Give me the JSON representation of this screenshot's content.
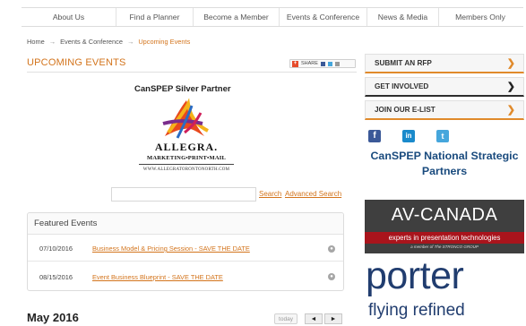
{
  "nav": {
    "items": [
      {
        "label": "About Us"
      },
      {
        "label": "Find a Planner"
      },
      {
        "label": "Become a Member"
      },
      {
        "label": "Events & Conference"
      },
      {
        "label": "News & Media"
      },
      {
        "label": "Members Only"
      }
    ]
  },
  "breadcrumb": {
    "home": "Home",
    "separator": "→",
    "section": "Events & Conference",
    "current": "Upcoming Events"
  },
  "main": {
    "title": "UPCOMING EVENTS",
    "share_label": "SHARE",
    "partner": {
      "title": "CanSPEP Silver Partner",
      "logo_name": "ALLEGRA.",
      "logo_tagline": "MARKETING•PRINT•MAIL",
      "logo_url": "WWW.ALLEGRATORONTONORTH.COM"
    },
    "search": {
      "value": "",
      "search_link": "Search",
      "advanced_link": "Advanced Search"
    },
    "featured": {
      "heading": "Featured Events",
      "events": [
        {
          "date": "07/10/2016",
          "title": "Business Model & Pricing Session - SAVE THE DATE"
        },
        {
          "date": "08/15/2016",
          "title": "Event Business Blueprint - SAVE THE DATE"
        }
      ]
    },
    "calendar": {
      "month": "May 2016",
      "today_label": "today",
      "prev_label": "◄",
      "next_label": "►"
    }
  },
  "sidebar": {
    "boxes": [
      {
        "label": "SUBMIT AN RFP",
        "chevron": "❯"
      },
      {
        "label": "GET INVOLVED",
        "chevron": "❯"
      },
      {
        "label": "JOIN OUR E-LIST",
        "chevron": "❯"
      }
    ],
    "social": {
      "facebook": "f",
      "linkedin": "in",
      "twitter": "t"
    },
    "strategic_title": "CanSPEP National Strategic Partners",
    "av_canada": {
      "name": "AV-CANADA",
      "tagline": "experts in presentation technologies",
      "member_note": "a member of The STRONCO GROUP"
    },
    "porter": {
      "name": "porter",
      "tagline": "flying refined"
    }
  },
  "colors": {
    "accent_orange": "#d3741c",
    "heading_blue": "#1a4b7e",
    "porter_navy": "#213d6f",
    "av_red": "#a9141c"
  }
}
